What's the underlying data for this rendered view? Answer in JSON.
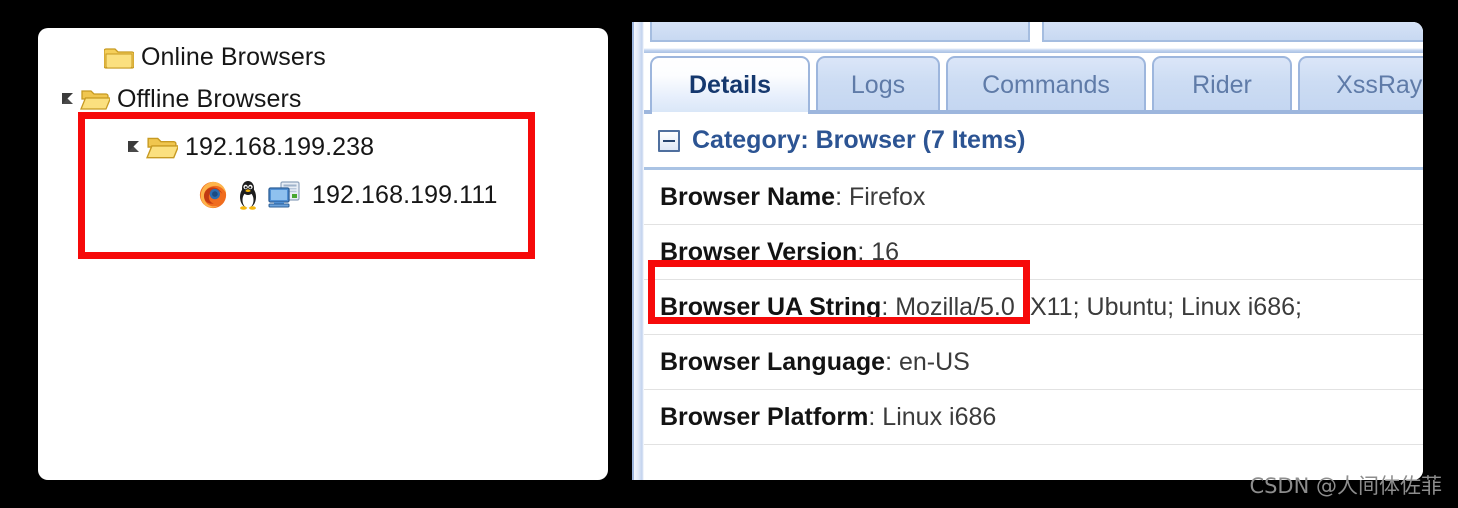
{
  "tree": {
    "name": "browser-tree",
    "nodes": [
      {
        "label": "Online Browsers",
        "icon": "folder-closed-icon",
        "twisty": "none",
        "indent": 0
      },
      {
        "label": "Offline Browsers",
        "icon": "folder-open-icon",
        "twisty": "expanded",
        "indent": 0
      },
      {
        "label": "192.168.199.238",
        "icon": "folder-open-icon",
        "twisty": "expanded",
        "indent": 1
      },
      {
        "label": "192.168.199.111",
        "icons": [
          "firefox-icon",
          "linux-tux-icon",
          "computer-icon"
        ],
        "twisty": "none",
        "indent": 2
      }
    ]
  },
  "details_panel": {
    "cut_tabs": [
      "",
      ""
    ],
    "tabs": [
      {
        "label": "Details",
        "active": true
      },
      {
        "label": "Logs",
        "active": false
      },
      {
        "label": "Commands",
        "active": false
      },
      {
        "label": "Rider",
        "active": false
      },
      {
        "label": "XssRays",
        "active": false
      }
    ],
    "category": {
      "toggle_icon": "collapse-minus-icon",
      "title": "Category: Browser (7 Items)"
    },
    "rows": [
      {
        "key": "Browser Name",
        "value": "Firefox"
      },
      {
        "key": "Browser Version",
        "value": "16"
      },
      {
        "key": "Browser UA String",
        "value": "Mozilla/5.0 (X11; Ubuntu; Linux i686;"
      },
      {
        "key": "Browser Language",
        "value": "en-US"
      },
      {
        "key": "Browser Platform",
        "value": "Linux i686"
      }
    ]
  },
  "annotations": {
    "color": "#f60a0a",
    "boxes": [
      {
        "name": "tree-highlight",
        "target": "192.168.199.238 / 192.168.199.111"
      },
      {
        "name": "version-highlight",
        "target": "Browser Version: 16"
      }
    ]
  },
  "watermark": {
    "text": "CSDN @人间体佐菲"
  }
}
